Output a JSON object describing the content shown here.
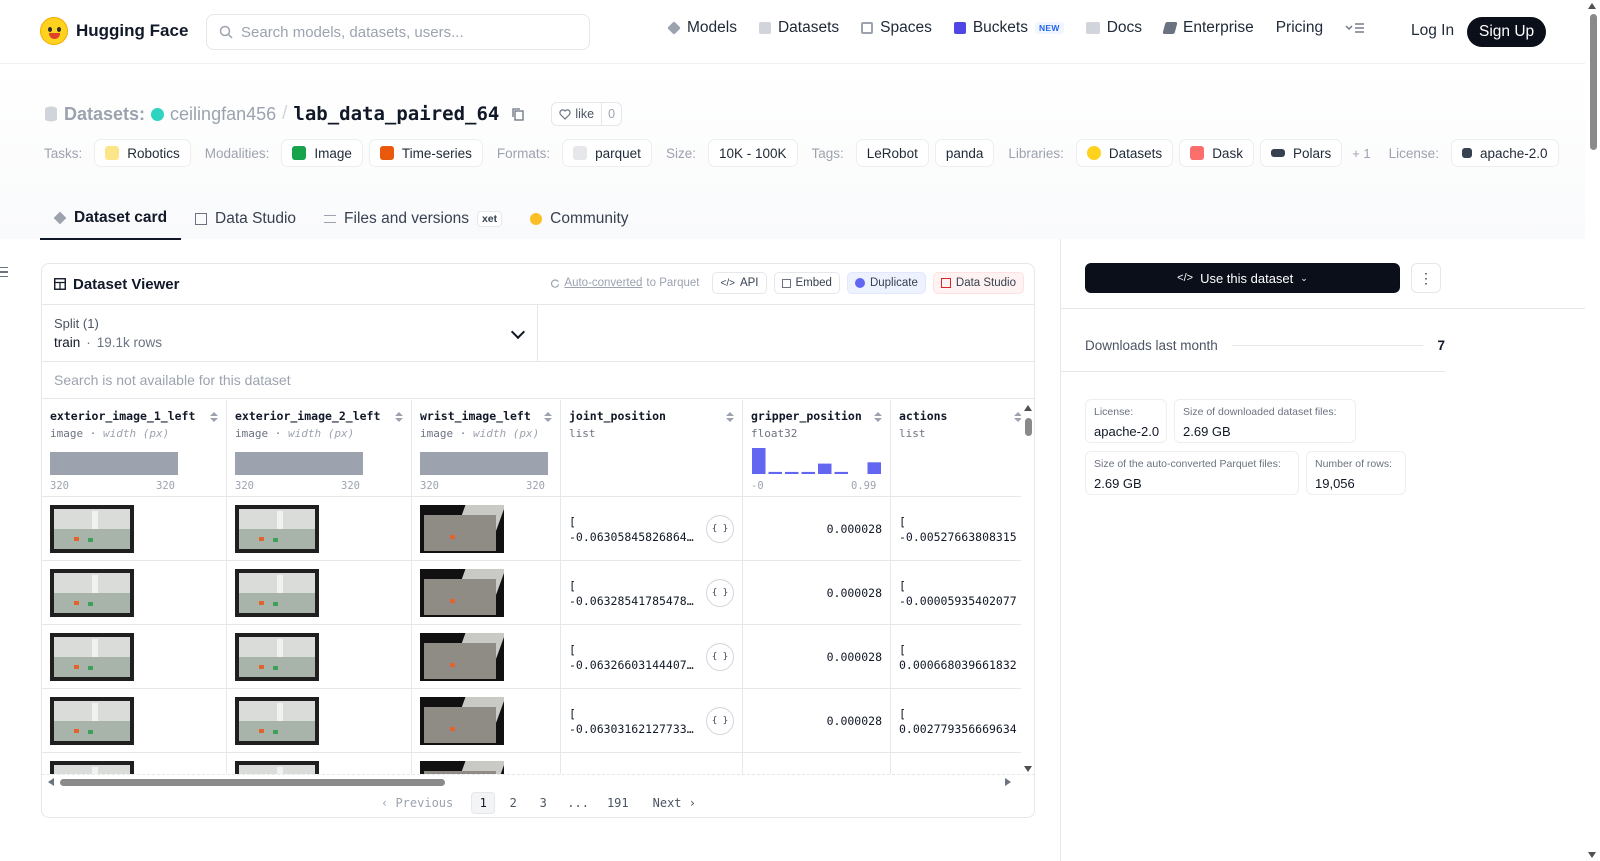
{
  "nav": {
    "brand": "Hugging Face",
    "search_placeholder": "Search models, datasets, users...",
    "items": [
      {
        "label": "Models",
        "icon": "cube-icon"
      },
      {
        "label": "Datasets",
        "icon": "database-icon"
      },
      {
        "label": "Spaces",
        "icon": "grid-icon"
      },
      {
        "label": "Buckets",
        "icon": "bucket-icon",
        "badge": "NEW"
      },
      {
        "label": "Docs",
        "icon": "book-icon"
      },
      {
        "label": "Enterprise",
        "icon": "building-icon"
      },
      {
        "label": "Pricing"
      }
    ],
    "login": "Log In",
    "signup": "Sign Up"
  },
  "repo": {
    "type_label": "Datasets:",
    "owner": "ceilingfan456",
    "separator": "/",
    "name": "lab_data_paired_64",
    "like_label": "like",
    "like_count": "0"
  },
  "tags": {
    "tasks_label": "Tasks:",
    "tasks": [
      "Robotics"
    ],
    "modalities_label": "Modalities:",
    "modalities": [
      "Image",
      "Time-series"
    ],
    "formats_label": "Formats:",
    "formats": [
      "parquet"
    ],
    "size_label": "Size:",
    "size": [
      "10K - 100K"
    ],
    "tags_label": "Tags:",
    "tags": [
      "LeRobot",
      "panda"
    ],
    "libraries_label": "Libraries:",
    "libraries": [
      "Datasets",
      "Dask",
      "Polars"
    ],
    "libraries_more": "+ 1",
    "license_label": "License:",
    "license": "apache-2.0"
  },
  "tabs": [
    {
      "label": "Dataset card",
      "active": true
    },
    {
      "label": "Data Studio"
    },
    {
      "label": "Files and versions",
      "badge": "xet"
    },
    {
      "label": "Community"
    }
  ],
  "viewer": {
    "title": "Dataset Viewer",
    "auto_converted_link": "Auto-converted",
    "auto_converted_rest": "to Parquet",
    "buttons": [
      "API",
      "Embed",
      "Duplicate",
      "Data Studio"
    ],
    "split_label": "Split (1)",
    "split_name": "train",
    "split_rows": "19.1k rows",
    "search_na": "Search is not available for this dataset",
    "columns": [
      {
        "name": "exterior_image_1_left",
        "type": "image",
        "type_extra": "width (px)",
        "min": "320",
        "max": "320"
      },
      {
        "name": "exterior_image_2_left",
        "type": "image",
        "type_extra": "width (px)",
        "min": "320",
        "max": "320"
      },
      {
        "name": "wrist_image_left",
        "type": "image",
        "type_extra": "width (px)",
        "min": "320",
        "max": "320"
      },
      {
        "name": "joint_position",
        "type": "list"
      },
      {
        "name": "gripper_position",
        "type": "float32",
        "min": "-0",
        "max": "0.99",
        "histogram": [
          1.0,
          0.08,
          0.08,
          0.08,
          0.4,
          0.08,
          0.0,
          0.45
        ]
      },
      {
        "name": "actions",
        "type": "list"
      }
    ],
    "rows": [
      {
        "joint_open": "[",
        "joint": "-0.06305845826864...",
        "gripper": "0.000028",
        "actions_open": "[",
        "actions": "-0.00527663808315"
      },
      {
        "joint_open": "[",
        "joint": "-0.06328541785478...",
        "gripper": "0.000028",
        "actions_open": "[",
        "actions": "-0.00005935402077"
      },
      {
        "joint_open": "[",
        "joint": "-0.06326603144407...",
        "gripper": "0.000028",
        "actions_open": "[",
        "actions": "0.000668039661832"
      },
      {
        "joint_open": "[",
        "joint": "-0.06303162127733...",
        "gripper": "0.000028",
        "actions_open": "[",
        "actions": "0.002779356669634"
      }
    ],
    "json_btn": "{ }",
    "pagination": {
      "previous": "Previous",
      "pages": [
        "1",
        "2",
        "3",
        "...",
        "191"
      ],
      "next": "Next",
      "current": "1"
    }
  },
  "sidebar": {
    "use_button": "Use this dataset",
    "downloads_label": "Downloads last month",
    "downloads_value": "7",
    "stats": [
      {
        "k": "License:",
        "v": "apache-2.0"
      },
      {
        "k": "Size of downloaded dataset files:",
        "v": "2.69 GB"
      },
      {
        "k": "Size of the auto-converted Parquet files:",
        "v": "2.69 GB"
      },
      {
        "k": "Number of rows:",
        "v": "19,056"
      }
    ]
  },
  "colors": {
    "accent_dark": "#0b0f19",
    "histogram": "#6366f1",
    "owner_dot": "#2dd4bf"
  }
}
